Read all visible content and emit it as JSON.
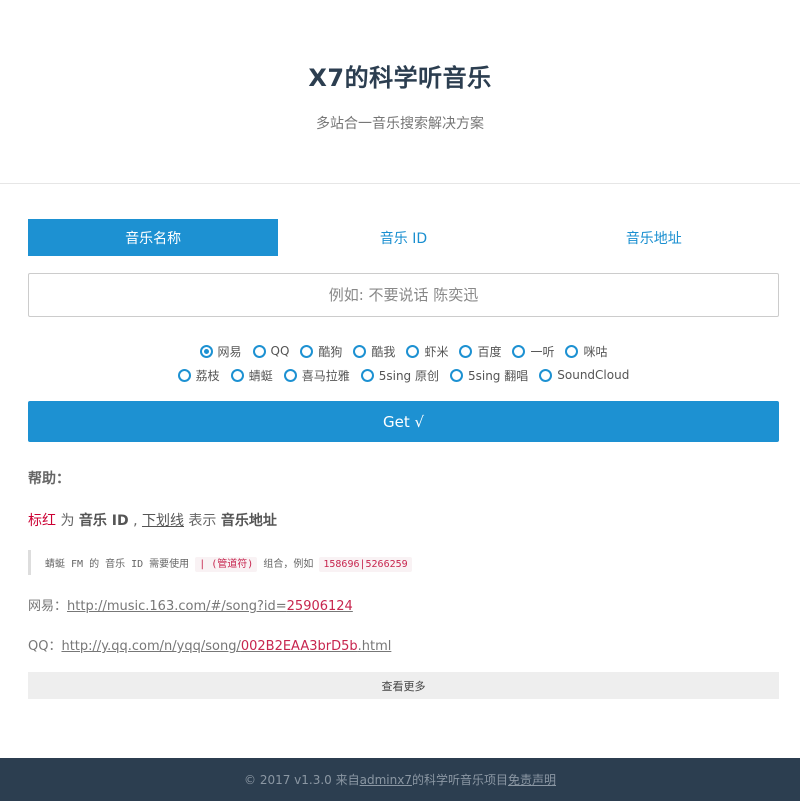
{
  "header": {
    "title": "X7的科学听音乐",
    "subtitle": "多站合一音乐搜索解决方案"
  },
  "tabs": [
    {
      "label": "音乐名称",
      "active": true
    },
    {
      "label": "音乐 ID",
      "active": false
    },
    {
      "label": "音乐地址",
      "active": false
    }
  ],
  "search": {
    "placeholder": "例如: 不要说话 陈奕迅",
    "value": ""
  },
  "sources": {
    "row1": [
      "网易",
      "QQ",
      "酷狗",
      "酷我",
      "虾米",
      "百度",
      "一听",
      "咪咕"
    ],
    "row2": [
      "荔枝",
      "蜻蜓",
      "喜马拉雅",
      "5sing 原创",
      "5sing 翻唱",
      "SoundCloud"
    ],
    "selected": "网易"
  },
  "get_button": "Get √",
  "help": {
    "title": "帮助：",
    "legend_red": "标红",
    "legend_wei": " 为 ",
    "legend_id": "音乐 ID",
    "legend_comma": " , ",
    "legend_underline": "下划线",
    "legend_biaoshi": " 表示 ",
    "legend_url": "音乐地址",
    "note_prefix": "蜻蜓 FM 的 音乐 ID 需要使用 ",
    "note_code1": "| (管道符)",
    "note_mid": " 组合，例如 ",
    "note_code2": "158696|5266259",
    "ex1_label": "网易：",
    "ex1_url_prefix": "http://music.163.com/#/song?id=",
    "ex1_url_id": "25906124",
    "ex2_label": "QQ：",
    "ex2_url_prefix": "http://y.qq.com/n/yqq/song/",
    "ex2_url_id": "002B2EAA3brD5b",
    "ex2_url_suffix": ".html"
  },
  "more_button": "查看更多",
  "footer": {
    "prefix": "© 2017 v1.3.0 来自",
    "author": "adminx7",
    "middle": "的科学听音乐项目 ",
    "disclaimer": "免责声明"
  },
  "colors": {
    "accent": "#1d91d2",
    "title": "#2c3e50",
    "footer_bg": "#2c3e50",
    "highlight": "#c7254e"
  }
}
